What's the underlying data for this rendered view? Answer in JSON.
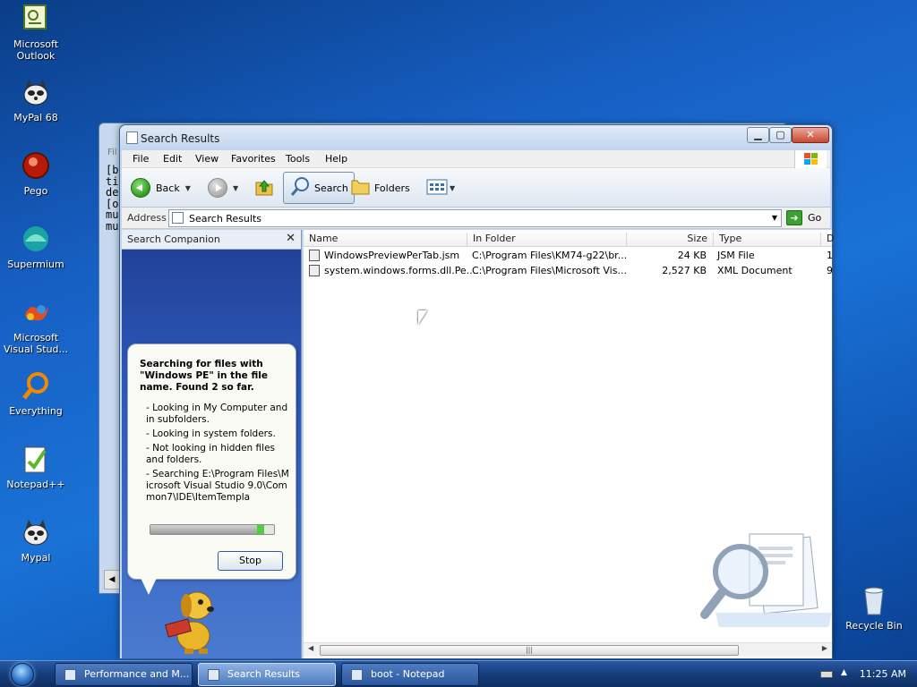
{
  "desktop": {
    "icons": [
      {
        "label": "Microsoft Outlook",
        "icon": "outlook-icon"
      },
      {
        "label": "MyPal 68",
        "icon": "mypal-icon"
      },
      {
        "label": "Pego",
        "icon": "pego-icon"
      },
      {
        "label": "Supermium",
        "icon": "supermium-icon"
      },
      {
        "label": "Microsoft Visual Stud...",
        "icon": "visual-studio-icon"
      },
      {
        "label": "Everything",
        "icon": "everything-icon"
      },
      {
        "label": "Notepad++",
        "icon": "notepadpp-icon"
      },
      {
        "label": "Mypal",
        "icon": "mypal-icon"
      }
    ],
    "recycle_bin": "Recycle Bin"
  },
  "background_window": {
    "menu_fragment": "Fil",
    "text_lines": [
      "[b",
      "ti",
      "de",
      "[o",
      "mu",
      "mu"
    ]
  },
  "window": {
    "title": "Search Results",
    "menu": [
      "File",
      "Edit",
      "View",
      "Favorites",
      "Tools",
      "Help"
    ],
    "toolbar": {
      "back": "Back",
      "search": "Search",
      "folders": "Folders"
    },
    "address": {
      "label": "Address",
      "value": "Search Results",
      "go": "Go"
    }
  },
  "companion": {
    "title": "Search Companion",
    "heading": "Searching for files with \"Windows PE\" in the file name.  Found 2 so far.",
    "status_items": [
      "- Looking in My Computer and in subfolders.",
      "- Looking in system folders.",
      "- Not looking in hidden files and folders.",
      "- Searching E:\\Program Files\\Microsoft Visual Studio 9.0\\Common7\\IDE\\ItemTempla"
    ],
    "progress": 0.92,
    "stop": "Stop"
  },
  "results": {
    "columns": [
      "Name",
      "In Folder",
      "Size",
      "Type",
      "D"
    ],
    "rows": [
      {
        "name": "WindowsPreviewPerTab.jsm",
        "folder": "C:\\Program Files\\KM74-g22\\br...",
        "size": "24 KB",
        "type": "JSM File",
        "date": "1"
      },
      {
        "name": "system.windows.forms.dll.Pe...",
        "folder": "C:\\Program Files\\Microsoft Vis...",
        "size": "2,527 KB",
        "type": "XML Document",
        "date": "9"
      }
    ]
  },
  "taskbar": {
    "tasks": [
      {
        "label": "Performance and M...",
        "active": false
      },
      {
        "label": "Search Results",
        "active": true
      },
      {
        "label": "boot - Notepad",
        "active": false
      }
    ],
    "clock": "11:25 AM"
  }
}
